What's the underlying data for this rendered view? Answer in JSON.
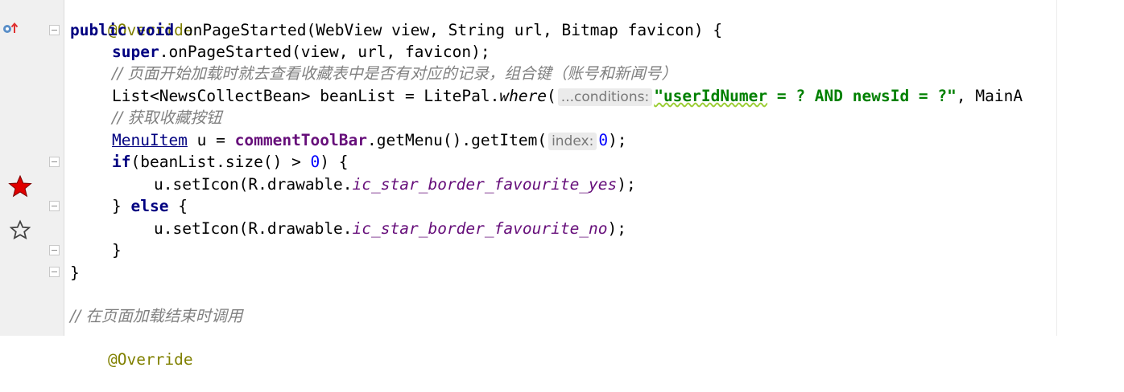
{
  "gutter": {
    "override_icon": "override-method-icon",
    "star_filled_icon": "star-filled-icon",
    "star_outline_icon": "star-outline-icon",
    "star_filled_color": "#e00000"
  },
  "code": {
    "l1_anno": "@Override",
    "l2_kw": "public void",
    "l2_rest": " onPageStarted(WebView view, String url, Bitmap favicon) {",
    "l3_super": "super",
    "l3_rest": ".onPageStarted(view, url, favicon);",
    "l4_comment": "// 页面开始加载时就去查看收藏表中是否有对应的记录，组合键（账号和新闻号）",
    "l5_a": "List<NewsCollectBean> beanList = LitePal.",
    "l5_where": "where",
    "l5_b": "(",
    "l5_hint": "...conditions:",
    "l5_str_a": "\"userIdNumer",
    "l5_str_b": " = ? AND newsId = ?\"",
    "l5_c": ", MainA",
    "l6_comment": "// 获取收藏按钮",
    "l7_type": "MenuItem",
    "l7_a": " u = ",
    "l7_field": "commentToolBar",
    "l7_b": ".getMenu().getItem(",
    "l7_hint": "index:",
    "l7_num": "0",
    "l7_c": ");",
    "l8_kw": "if",
    "l8_a": "(beanList.size() > ",
    "l8_num": "0",
    "l8_b": ") {",
    "l9_a": "u.setIcon(R.drawable.",
    "l9_field": "ic_star_border_favourite_yes",
    "l9_b": ");",
    "l10_a": "} ",
    "l10_kw": "else",
    "l10_b": " {",
    "l11_a": "u.setIcon(R.drawable.",
    "l11_field": "ic_star_border_favourite_no",
    "l11_b": ");",
    "l12": "}",
    "l13": "}",
    "l15_comment": "// 在页面加载结束时调用",
    "l16_anno": "@Override"
  }
}
